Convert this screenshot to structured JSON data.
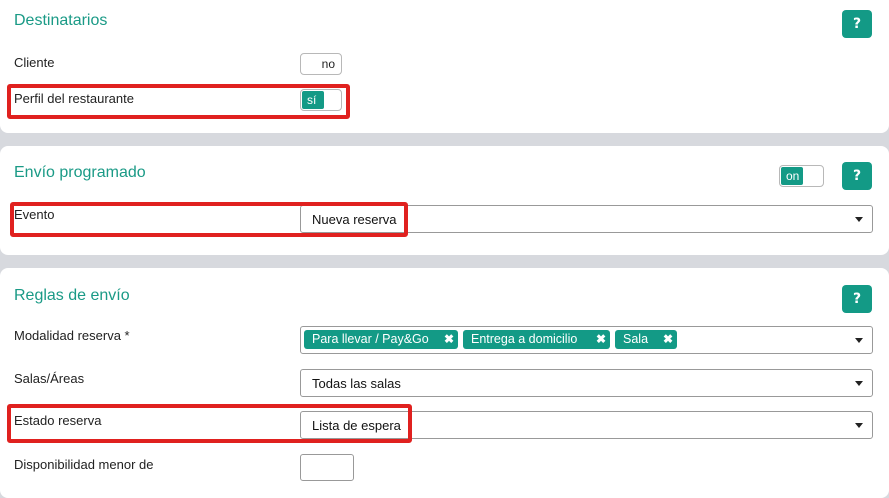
{
  "recipients": {
    "title": "Destinatarios",
    "help": "?",
    "client_label": "Cliente",
    "client_toggle": "no",
    "restaurant_label": "Perfil del restaurante",
    "restaurant_toggle": "sí"
  },
  "scheduled": {
    "title": "Envío programado",
    "toggle": "on",
    "help": "?",
    "event_label": "Evento",
    "event_value": "Nueva reserva"
  },
  "rules": {
    "title": "Reglas de envío",
    "help": "?",
    "modality_label": "Modalidad reserva *",
    "modality_chips": [
      "Para llevar / Pay&Go",
      "Entrega a domicilio",
      "Sala"
    ],
    "chip_remove": "✖",
    "rooms_label": "Salas/Áreas",
    "rooms_value": "Todas las salas",
    "state_label": "Estado reserva",
    "state_value": "Lista de espera",
    "availability_label": "Disponibilidad menor de"
  },
  "colors": {
    "accent": "#139a86",
    "highlight": "#e0211f"
  }
}
